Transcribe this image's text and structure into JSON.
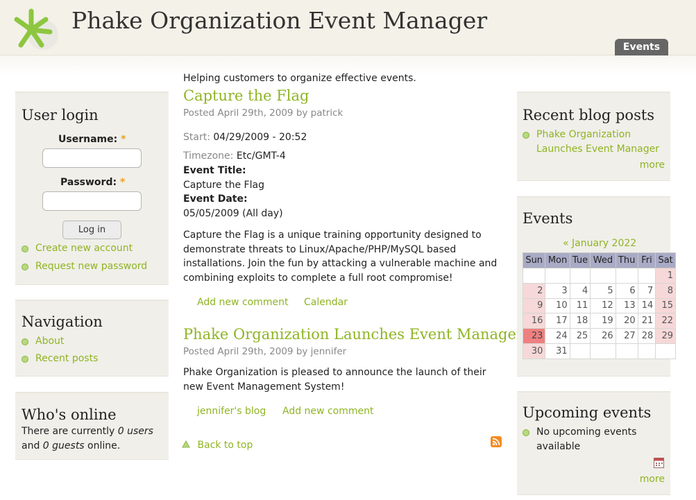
{
  "header": {
    "site_name": "Phake Organization Event Manager",
    "tab_events": "Events",
    "slogan": "Helping customers to organize effective events."
  },
  "user_login": {
    "title": "User login",
    "username_label": "Username:",
    "password_label": "Password:",
    "required_mark": "*",
    "username_value": "",
    "password_value": "",
    "login_button": "Log in",
    "links": [
      "Create new account",
      "Request new password"
    ]
  },
  "navigation": {
    "title": "Navigation",
    "links": [
      "About",
      "Recent posts"
    ]
  },
  "whos_online": {
    "title": "Who's online",
    "text_pre": "There are currently ",
    "users": "0 users",
    "and": "and ",
    "guests": "0 guests",
    "text_post": " online."
  },
  "posts": [
    {
      "title": "Capture the Flag",
      "meta": "Posted April 29th, 2009 by patrick",
      "start_label": "Start:",
      "start_value": "04/29/2009 - 20:52",
      "timezone_label": "Timezone:",
      "timezone_value": "Etc/GMT-4",
      "event_title_label": "Event Title:",
      "event_title_value": "Capture the Flag",
      "event_date_label": "Event Date:",
      "event_date_value": "05/05/2009 (All day)",
      "body": [
        "Capture the Flag is a unique training opportunity designed to",
        "demonstrate threats to Linux/Apache/PHP/MySQL based",
        "installations. Join the fun by attacking a vulnerable machine and",
        "combining exploits to complete a full root compromise!"
      ],
      "links": [
        "Add new comment",
        "Calendar"
      ]
    },
    {
      "title": "Phake Organization Launches Event Manager",
      "meta": "Posted April 29th, 2009 by jennifer",
      "body": [
        "Phake Organization is pleased to announce the launch of their",
        "new Event Management System!"
      ],
      "links": [
        "jennifer's blog",
        "Add new comment"
      ]
    }
  ],
  "back_to_top": "Back to top",
  "recent_blog": {
    "title": "Recent blog posts",
    "item_lines": [
      "Phake Organization",
      "Launches Event Manager"
    ],
    "more": "more"
  },
  "events_block": {
    "title": "Events",
    "month_nav": "« January 2022",
    "weekdays": [
      "Sun",
      "Mon",
      "Tue",
      "Wed",
      "Thu",
      "Fri",
      "Sat"
    ],
    "today": "23",
    "weeks": [
      [
        "",
        "",
        "",
        "",
        "",
        "",
        "1"
      ],
      [
        "2",
        "3",
        "4",
        "5",
        "6",
        "7",
        "8"
      ],
      [
        "9",
        "10",
        "11",
        "12",
        "13",
        "14",
        "15"
      ],
      [
        "16",
        "17",
        "18",
        "19",
        "20",
        "21",
        "22"
      ],
      [
        "23",
        "24",
        "25",
        "26",
        "27",
        "28",
        "29"
      ],
      [
        "30",
        "31",
        "",
        "",
        "",
        "",
        ""
      ]
    ]
  },
  "upcoming": {
    "title": "Upcoming events",
    "item_lines": [
      "No upcoming events",
      "available"
    ],
    "more": "more"
  },
  "colors": {
    "link": "#8fb424",
    "sidebar_bg": "#f0efe9",
    "calendar_header": "#a9aac5",
    "weekend": "#f7d8d8",
    "today": "#ef8080",
    "tab_bg": "#666666"
  },
  "icons": [
    "logo-icon",
    "bullet-icon",
    "up-arrow-icon",
    "rss-feed-icon",
    "ical-icon"
  ]
}
